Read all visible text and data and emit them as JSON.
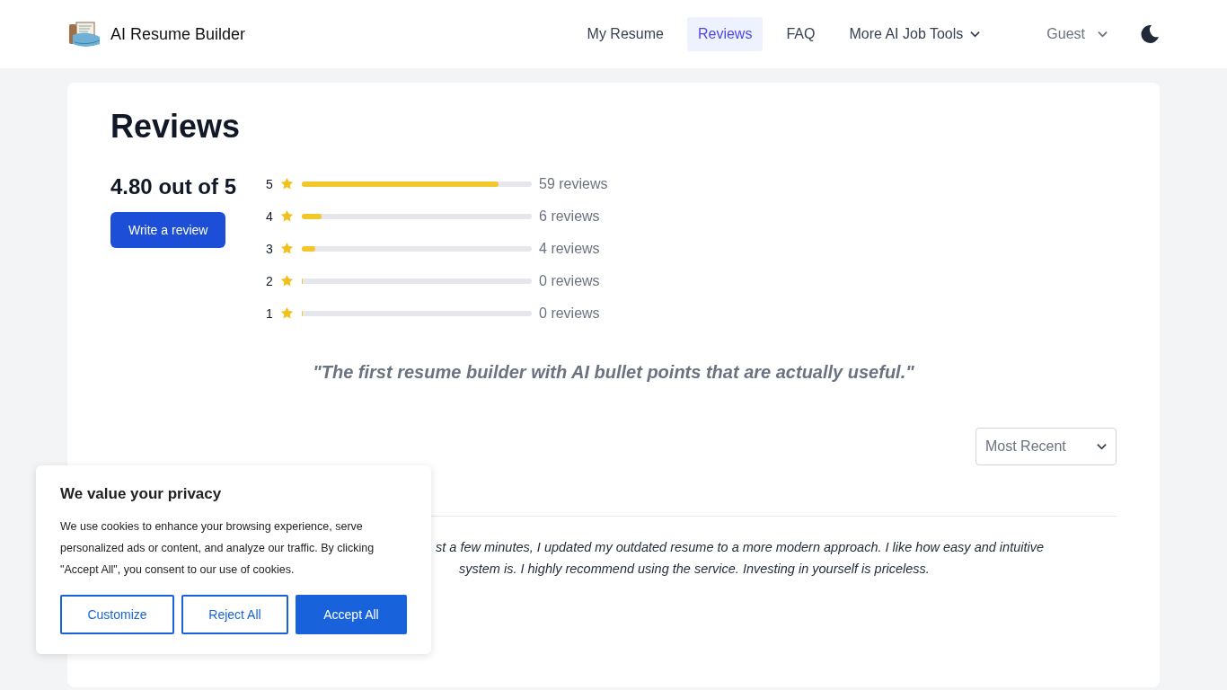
{
  "header": {
    "brand": "AI Resume Builder",
    "nav": [
      {
        "label": "My Resume",
        "selected": false,
        "dropdown": false
      },
      {
        "label": "Reviews",
        "selected": true,
        "dropdown": false
      },
      {
        "label": "FAQ",
        "selected": false,
        "dropdown": false
      },
      {
        "label": "More AI Job Tools",
        "selected": false,
        "dropdown": true
      }
    ],
    "user": "Guest"
  },
  "page": {
    "title": "Reviews",
    "average": "4.80 out of 5",
    "write_button": "Write a review",
    "ratings": [
      {
        "stars_label": "5",
        "level": 0.855,
        "reading": "59 reviews"
      },
      {
        "stars_label": "4",
        "level": 0.087,
        "reading": "6 reviews"
      },
      {
        "stars_label": "3",
        "level": 0.058,
        "reading": "4 reviews"
      },
      {
        "stars_label": "2",
        "level": 0,
        "reading": "0 reviews"
      },
      {
        "stars_label": "1",
        "level": 0,
        "reading": "0 reviews"
      }
    ],
    "quote": "\"The first resume builder with AI bullet points that are actually useful.\"",
    "sort": {
      "value": "Most Recent"
    },
    "review_lines": [
      "st a few minutes, I updated my outdated resume to a more modern approach. I like how easy and intuitive",
      "system is. I highly recommend using the service. Investing in yourself is priceless."
    ]
  },
  "cookie_banner": {
    "title": "We value your privacy",
    "text": "We use cookies to enhance your browsing experience, serve personalized ads or content, and analyze our traffic. By clicking \"Accept All\", you consent to our use of cookies.",
    "buttons": [
      {
        "label": "Customize",
        "kind": "outline"
      },
      {
        "label": "Reject All",
        "kind": "outline"
      },
      {
        "label": "Accept All",
        "kind": "primary"
      }
    ]
  }
}
